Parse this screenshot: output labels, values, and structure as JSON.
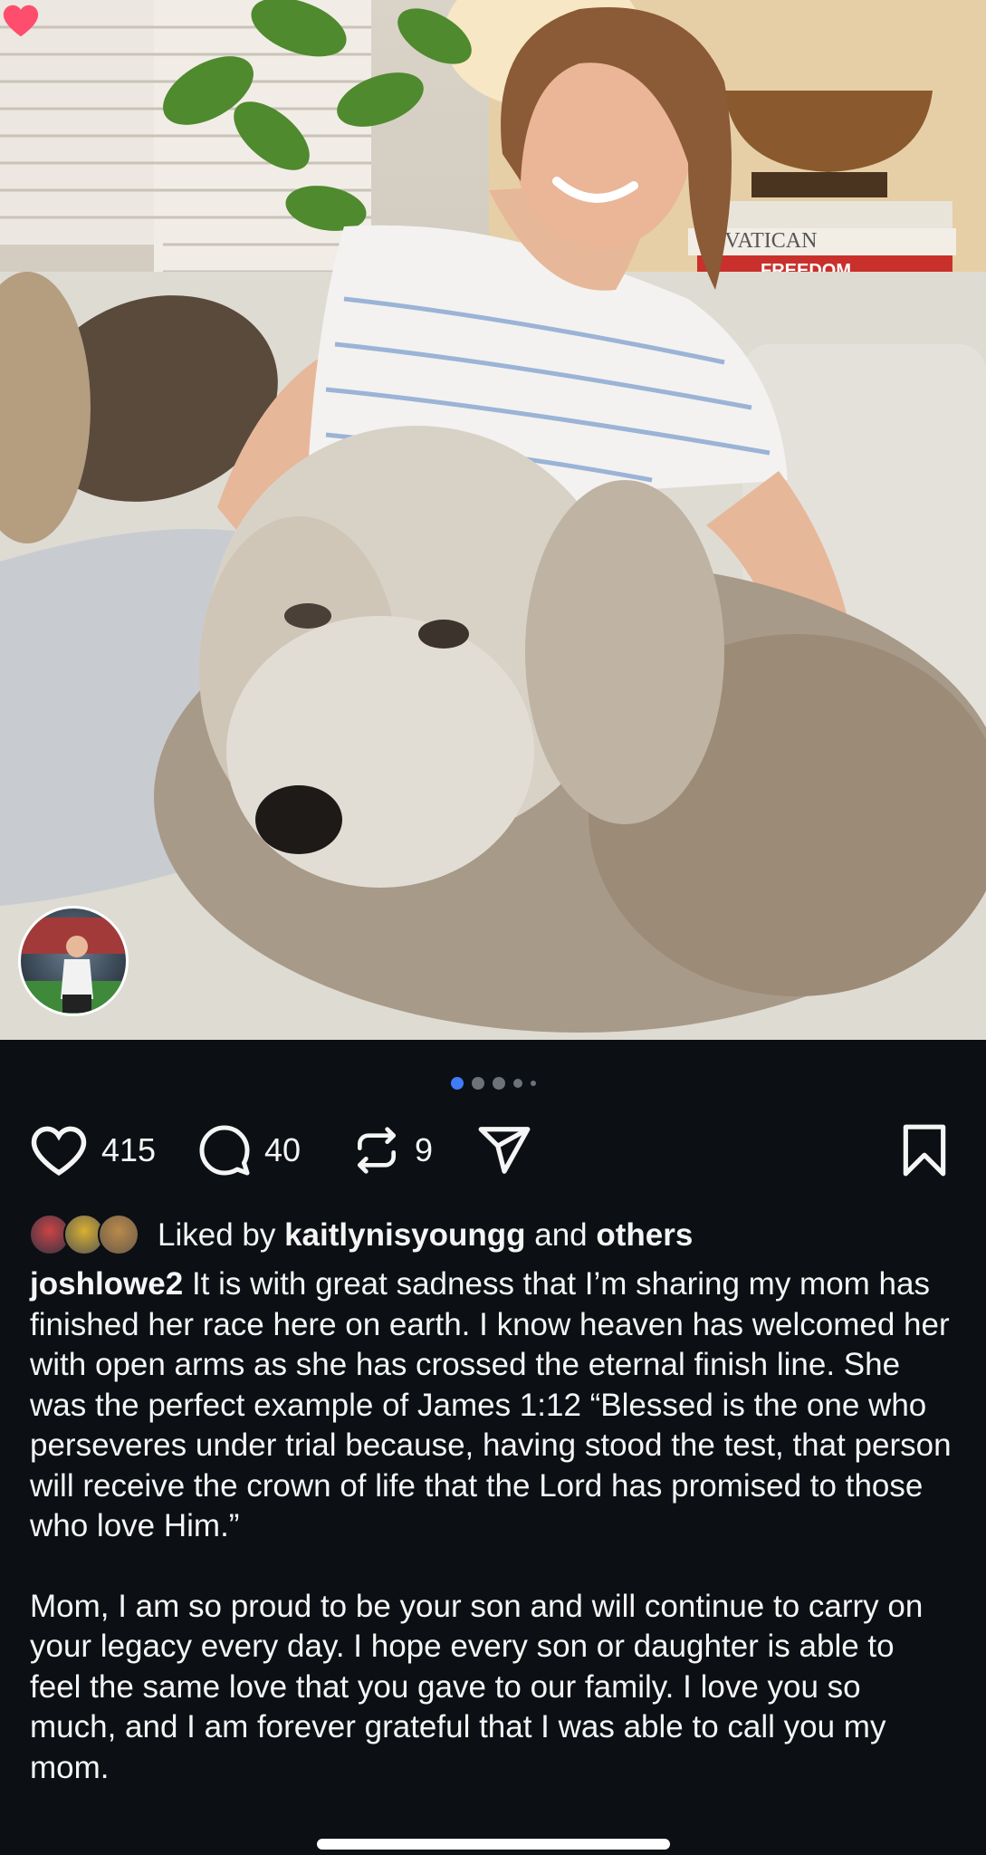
{
  "photo": {
    "description_icon": "photo-post-image",
    "book_top": "E VATICAN",
    "book_bottom": "FREEDOM"
  },
  "carousel": {
    "count": 5,
    "active_index": 0
  },
  "actions": {
    "like_icon": "heart-icon",
    "like_count": "415",
    "comment_icon": "comment-icon",
    "comment_count": "40",
    "repost_icon": "repost-icon",
    "repost_count": "9",
    "share_icon": "send-icon",
    "save_icon": "bookmark-icon"
  },
  "likes": {
    "prefix": "Liked by ",
    "user": "kaitlynisyoungg",
    "middle": " and ",
    "others": "others"
  },
  "caption": {
    "username": "joshlowe2",
    "text1": " It is with great sadness that I’m sharing my mom has finished her race here on earth. I know heaven has welcomed her with open arms as she has crossed the eternal finish line. She was the perfect example of James 1:12 “Blessed is the one who perseveres under trial because, having stood the test, that person will receive the crown of life that the Lord has promised to those who love Him.”",
    "text2": "Mom, I am so proud to be your son and will continue to carry on your legacy every day. I hope every son or daughter is able to feel the same love that you gave to our family. I love you so much, and I am forever grateful that I was able to call you my mom."
  },
  "colors": {
    "background": "#0c1014",
    "accent_dot": "#3f7cf5",
    "heart_pink": "#ff4d6d"
  }
}
